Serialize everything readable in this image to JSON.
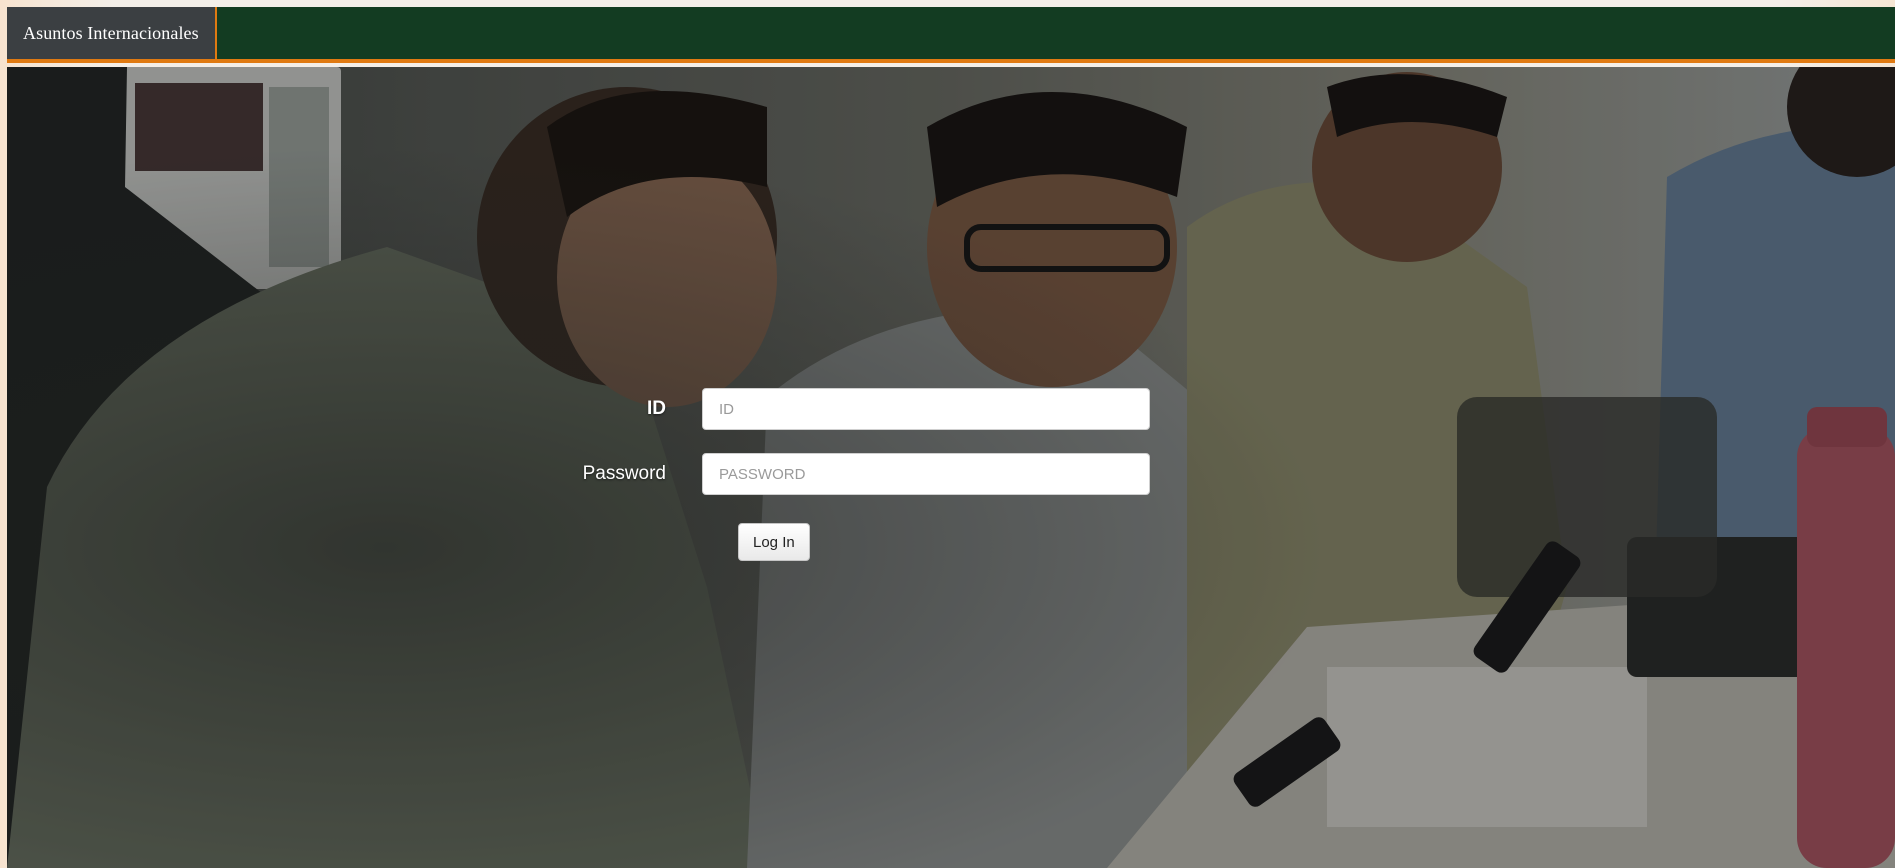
{
  "navbar": {
    "brand": "Asuntos Internacionales",
    "background": "#133c22",
    "accent": "#e07a12"
  },
  "login": {
    "id_label": "ID",
    "id_placeholder": "ID",
    "password_label": "Password",
    "password_placeholder": "PASSWORD",
    "submit_label": "Log In"
  }
}
